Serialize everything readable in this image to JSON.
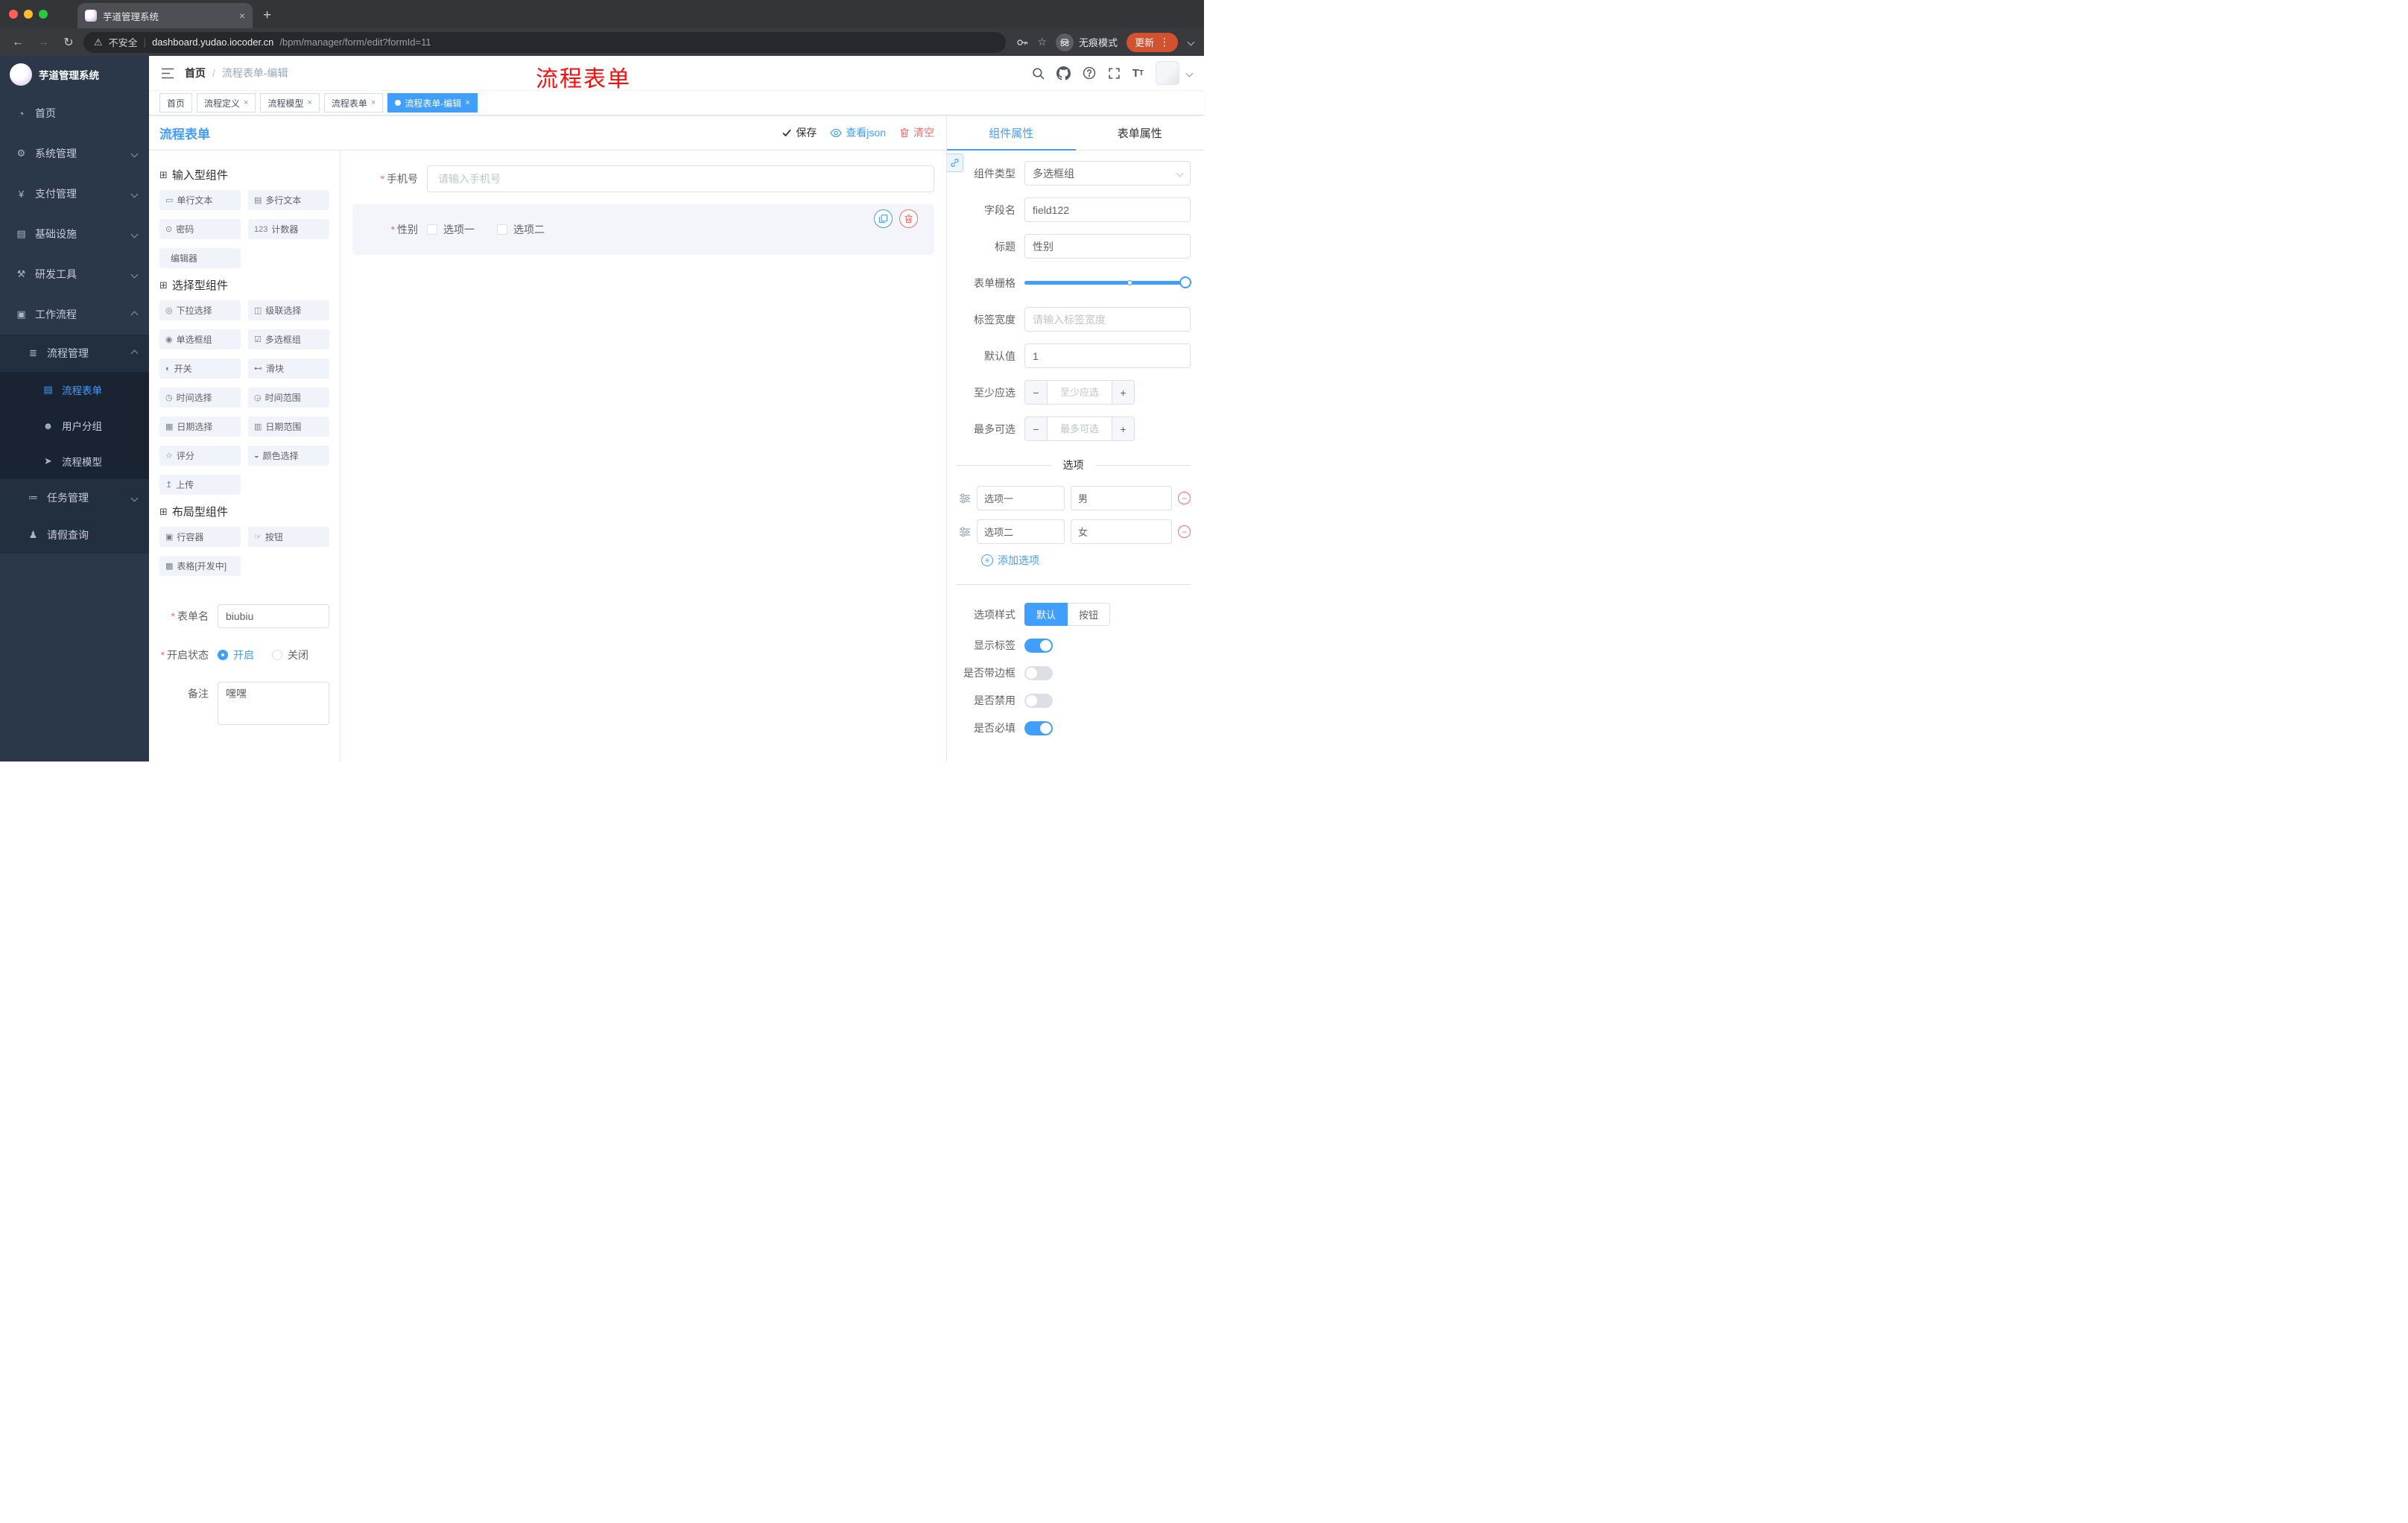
{
  "colors": {
    "accent": "#409eff",
    "danger": "#f56c6c",
    "tag_active": "#409eff",
    "overlay_title_red": "#fb0d0d",
    "sidebar_bg": "#2b384a",
    "update_pill": "#d2512e"
  },
  "browser": {
    "tab_title": "芋道管理系统",
    "security_label": "不安全",
    "url_host": "dashboard.yudao.iocoder.cn",
    "url_path": "/bpm/manager/form/edit?formId=11",
    "incognito_label": "无痕模式",
    "update_label": "更新"
  },
  "sidebar": {
    "logo_title": "芋道管理系统",
    "items": [
      {
        "label": "首页",
        "icon": "dashboard-icon",
        "glyph": "◔"
      },
      {
        "label": "系统管理",
        "icon": "system-icon",
        "glyph": "⚙"
      },
      {
        "label": "支付管理",
        "icon": "payment-icon",
        "glyph": "¥"
      },
      {
        "label": "基础设施",
        "icon": "infrastructure-icon",
        "glyph": "▤"
      },
      {
        "label": "研发工具",
        "icon": "devtools-icon",
        "glyph": "⚒"
      },
      {
        "label": "工作流程",
        "icon": "workflow-icon",
        "glyph": "▣"
      }
    ],
    "process_group": {
      "label": "流程管理",
      "glyph": "≣"
    },
    "process_children": [
      {
        "label": "流程表单",
        "glyph": "▤"
      },
      {
        "label": "用户分组",
        "glyph": "☻"
      },
      {
        "label": "流程模型",
        "glyph": "➤"
      }
    ],
    "task_group": {
      "label": "任务管理",
      "glyph": "≔"
    },
    "leave_item": {
      "label": "请假查询",
      "glyph": "♟"
    }
  },
  "header": {
    "breadcrumb_home": "首页",
    "breadcrumb_current": "流程表单-编辑",
    "overlay_title": "流程表单"
  },
  "tags": [
    {
      "label": "首页"
    },
    {
      "label": "流程定义"
    },
    {
      "label": "流程模型"
    },
    {
      "label": "流程表单"
    },
    {
      "label": "流程表单-编辑"
    }
  ],
  "designer": {
    "title": "流程表单",
    "actions": {
      "save": "保存",
      "view_json": "查看json",
      "clear": "清空"
    },
    "palette": {
      "group_icon_glyph": "⊞",
      "groups": [
        {
          "title": "输入型组件",
          "items": [
            {
              "label": "单行文本",
              "glyph": "▭"
            },
            {
              "label": "多行文本",
              "glyph": "▤"
            },
            {
              "label": "密码",
              "glyph": "⊙"
            },
            {
              "label": "计数器",
              "glyph": "123"
            },
            {
              "label": "编辑器",
              "glyph": ""
            }
          ]
        },
        {
          "title": "选择型组件",
          "items": [
            {
              "label": "下拉选择",
              "glyph": "◎"
            },
            {
              "label": "级联选择",
              "glyph": "◫"
            },
            {
              "label": "单选框组",
              "glyph": "◉"
            },
            {
              "label": "多选框组",
              "glyph": "☑"
            },
            {
              "label": "开关",
              "glyph": "◐"
            },
            {
              "label": "滑块",
              "glyph": "⊷"
            },
            {
              "label": "时间选择",
              "glyph": "◷"
            },
            {
              "label": "时间范围",
              "glyph": "◶"
            },
            {
              "label": "日期选择",
              "glyph": "▦"
            },
            {
              "label": "日期范围",
              "glyph": "▥"
            },
            {
              "label": "评分",
              "glyph": "☆"
            },
            {
              "label": "颜色选择",
              "glyph": "◒"
            },
            {
              "label": "上传",
              "glyph": "↥"
            }
          ]
        },
        {
          "title": "布局型组件",
          "items": [
            {
              "label": "行容器",
              "glyph": "▣"
            },
            {
              "label": "按钮",
              "glyph": "☞"
            },
            {
              "label": "表格[开发中]",
              "glyph": "▩"
            }
          ]
        }
      ]
    },
    "meta": {
      "form_name_label": "表单名",
      "form_name_value": "biubiu",
      "status_label": "开启状态",
      "status_on": "开启",
      "status_off": "关闭",
      "remark_label": "备注",
      "remark_value": "嘿嘿"
    }
  },
  "canvas": {
    "phone": {
      "label": "手机号",
      "placeholder": "请输入手机号"
    },
    "gender": {
      "label": "性别",
      "options": [
        "选项一",
        "选项二"
      ]
    }
  },
  "props": {
    "tab_component": "组件属性",
    "tab_form": "表单属性",
    "component_type_label": "组件类型",
    "component_type_value": "多选框组",
    "field_name_label": "字段名",
    "field_name_value": "field122",
    "title_label": "标题",
    "title_value": "性别",
    "grid_label": "表单栅格",
    "label_width_label": "标签宽度",
    "label_width_placeholder": "请输入标签宽度",
    "default_label": "默认值",
    "default_value": "1",
    "min_label": "至少应选",
    "min_placeholder": "至少应选",
    "max_label": "最多可选",
    "max_placeholder": "最多可选",
    "options_title": "选项",
    "options": [
      {
        "value": "选项一",
        "text": "男"
      },
      {
        "value": "选项二",
        "text": "女"
      }
    ],
    "add_option_label": "添加选项",
    "style_label": "选项样式",
    "style_default": "默认",
    "style_button": "按钮",
    "switches": [
      {
        "label": "显示标签",
        "on": true
      },
      {
        "label": "是否带边框",
        "on": false
      },
      {
        "label": "是否禁用",
        "on": false
      },
      {
        "label": "是否必填",
        "on": true
      }
    ]
  }
}
